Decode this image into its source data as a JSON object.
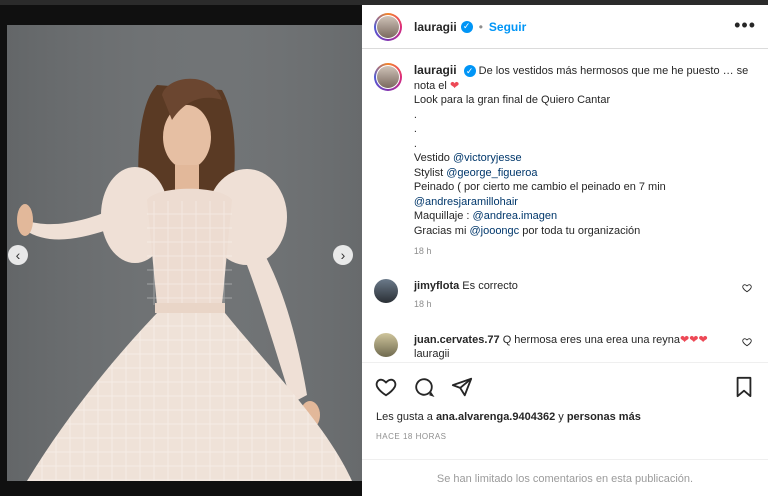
{
  "header": {
    "username": "lauragii",
    "separator": "•",
    "follow_label": "Seguir",
    "more_label": "•••"
  },
  "media": {
    "prev_label": "‹",
    "next_label": "›"
  },
  "caption": {
    "username": "lauragii",
    "line1": "De los vestidos más hermosos que me he puesto … se nota el",
    "line2": "Look para la gran final de Quiero Cantar",
    "dot1": ".",
    "dot2": ".",
    "dot3": ".",
    "vestido_label": "Vestido ",
    "vestido_mention": "@victoryjesse",
    "stylist_label": "Stylist ",
    "stylist_mention": "@george_figueroa",
    "peinado_text": "Peinado ( por cierto me cambio el peinado en 7 min",
    "peinado_mention": "@andresjaramillohair",
    "maquillaje_label": "Maquillaje : ",
    "maquillaje_mention": "@andrea.imagen",
    "gracias_pre": "Gracias mi ",
    "gracias_mention": "@jooongc",
    "gracias_post": " por toda tu organización",
    "time": "18 h"
  },
  "comments": [
    {
      "user": "jimyflota",
      "text": "Es correcto",
      "time": "18 h"
    },
    {
      "user": "juan.cervates.77",
      "text": "Q hermosa eres una erea una reyna",
      "hearts": "❤❤❤",
      "second_line": "lauragii"
    }
  ],
  "actions": {
    "likes_prefix": "Les gusta a ",
    "likes_user": "ana.alvarenga.9404362",
    "likes_mid": " y ",
    "likes_suffix": "personas más",
    "ago": "HACE 18 HORAS",
    "limited_notice": "Se han limitado los comentarios en esta publicación."
  },
  "colors": {
    "link": "#0095f6",
    "mention": "#00376b",
    "heart": "#ed4956"
  }
}
